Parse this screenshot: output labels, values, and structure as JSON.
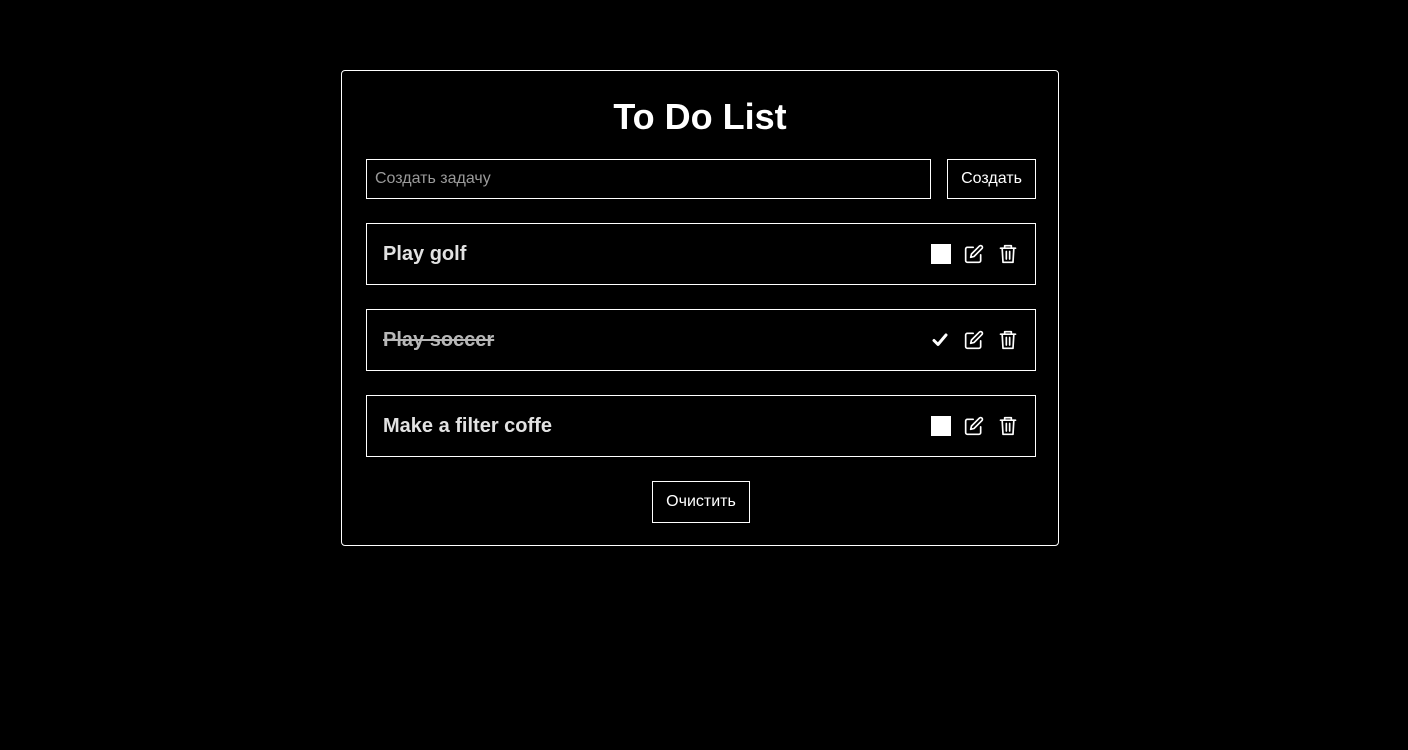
{
  "app": {
    "title": "To Do List"
  },
  "new_task": {
    "placeholder": "Создать задачу",
    "value": "",
    "create_label": "Создать"
  },
  "tasks": [
    {
      "text": "Play golf",
      "completed": false
    },
    {
      "text": "Play soccer",
      "completed": true
    },
    {
      "text": "Make a filter coffe",
      "completed": false
    }
  ],
  "clear_label": "Очистить",
  "icons": {
    "checkbox": "checkbox-icon",
    "check": "checkmark-icon",
    "edit": "edit-icon",
    "delete": "trash-icon"
  },
  "colors": {
    "background": "#000000",
    "foreground": "#ffffff",
    "placeholder": "#9a9a9a"
  }
}
